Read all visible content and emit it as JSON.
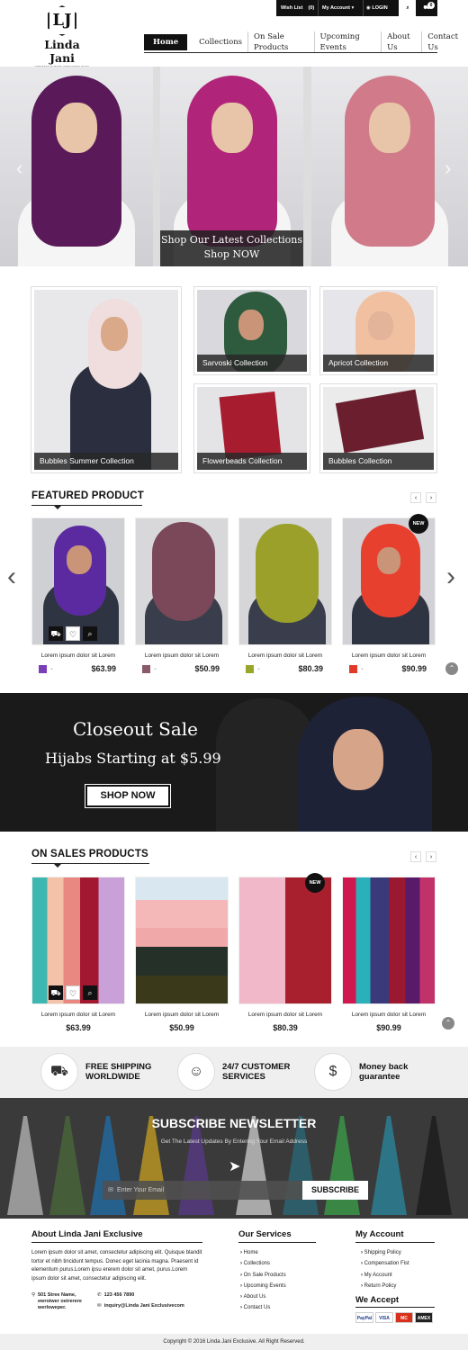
{
  "topbar": {
    "wishlist_label": "Wish List",
    "wishlist_count": "(0)",
    "account_label": "My Account",
    "login_label": "LOGIN",
    "cart_count": "0"
  },
  "brand": {
    "logo_mark": "LJ",
    "name": "Linda Jani",
    "tagline": "MODESTY IS MORE ATTRACTIVE THAN BEAUTY"
  },
  "nav": {
    "items": [
      "Home",
      "Collections",
      "On Sale Products",
      "Upcoming Events",
      "About Us",
      "Contact Us"
    ]
  },
  "hero": {
    "caption_line1": "Shop Our Latest Collections",
    "caption_line2": "Shop NOW",
    "prev_icon": "chevron-left-icon",
    "next_icon": "chevron-right-icon"
  },
  "collections": [
    "Bubbles Summer Collection",
    "Sarvoski Collection",
    "Apricot Collection",
    "Flowerbeads Collection",
    "Bubbles Collection"
  ],
  "featured": {
    "title": "FEATURED PRODUCT",
    "new_label": "NEW",
    "products": [
      {
        "name": "Lorem ipsum dolor sit  Lorem",
        "price": "$63.99",
        "color": "#7a3fb8"
      },
      {
        "name": "Lorem ipsum dolor sit  Lorem",
        "price": "$50.99",
        "color": "#8a5a6a"
      },
      {
        "name": "Lorem ipsum dolor sit  Lorem",
        "price": "$80.39",
        "color": "#9aa62a"
      },
      {
        "name": "Lorem ipsum dolor sit  Lorem",
        "price": "$90.99",
        "color": "#e03a2a"
      }
    ]
  },
  "banner": {
    "line1": "Closeout Sale",
    "line2": "Hijabs Starting at $5.99",
    "button": "SHOP NOW"
  },
  "on_sale": {
    "title": "ON SALES PRODUCTS",
    "new_label": "NEW",
    "products": [
      {
        "name": "Lorem ipsum dolor sit  Lorem",
        "price": "$63.99"
      },
      {
        "name": "Lorem ipsum dolor sit  Lorem",
        "price": "$50.99"
      },
      {
        "name": "Lorem ipsum dolor sit  Lorem",
        "price": "$80.39"
      },
      {
        "name": "Lorem ipsum dolor sit  Lorem",
        "price": "$90.99"
      }
    ]
  },
  "features": [
    {
      "line1": "FREE SHIPPING",
      "line2": "WORLDWIDE",
      "icon": "truck-icon"
    },
    {
      "line1": "24/7 CUSTOMER",
      "line2": "SERVICES",
      "icon": "support-agent-icon"
    },
    {
      "line1": "Money back",
      "line2": "guarantee",
      "icon": "dollar-coin-icon"
    }
  ],
  "newsletter": {
    "title": "SUBSCRIBE NEWSLETTER",
    "subtitle": "Get The Latest Updates By Entering Your Email Address",
    "placeholder": "Enter Your Email",
    "button": "SUBSCRIBE"
  },
  "footer": {
    "about_title": "About Linda Jani Exclusive",
    "about_text": "Lorem ipsum dolor sit amet, consectetur adipiscing elit. Quisque blandit tortor et nibh tincidunt tempus. Donec eget lacinia magna. Praesent id elementum purus.Lorem ipsu ererem dolor sit amet, purus.Lorem ipsum dolor sit amet, consectetur adipiscing elit.",
    "address": "501 Stree Name, ewroiwer oeirerere werloweper.",
    "phone": "123 456 7890",
    "email": "inquiry@Linda Jani Exclusivecom",
    "services_title": "Our Services",
    "services": [
      "Home",
      "Collections",
      "On Sale Products",
      "Upcoming Events",
      "About Us",
      "Contact Us"
    ],
    "account_title": "My Account",
    "account_links": [
      "Shipping Policy",
      "Compensation Fist",
      "My Account",
      "Return Policy"
    ],
    "accept_title": "We Accept",
    "payments": [
      "PayPal",
      "VISA",
      "MC",
      "AMEX"
    ],
    "copyright": "Copyright © 2016 Linda Jani Exclusive. All Right Reserved."
  },
  "colors": {
    "accent": "#111111",
    "footer_bg": "#efefef"
  }
}
